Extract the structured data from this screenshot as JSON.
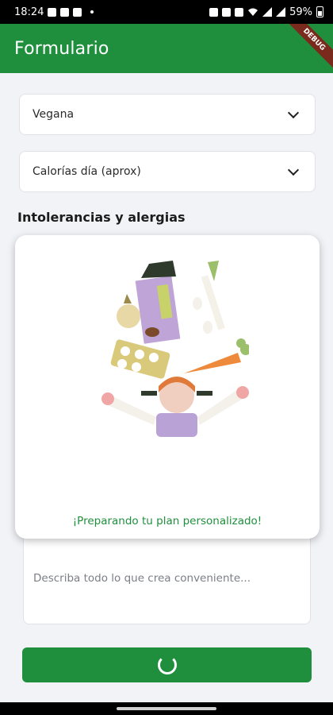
{
  "status_bar": {
    "time": "18:24",
    "battery": "59%"
  },
  "app_bar": {
    "title": "Formulario",
    "debug_label": "DEBUG"
  },
  "form": {
    "diet_select": {
      "value": "Vegana"
    },
    "calories_select": {
      "placeholder": "Calorías día (aprox)"
    },
    "allergies_title": "Intolerancias y alergias",
    "details_field": {
      "placeholder": "Describa todo lo que crea conveniente..."
    }
  },
  "loading_card": {
    "message": "¡Preparando tu plan personalizado!"
  },
  "colors": {
    "primary": "#1f8f3d",
    "background": "#f1f3f7",
    "card": "#ffffff"
  },
  "icons": [
    "picture-icon",
    "youtube-icon",
    "twitch-icon",
    "lock-icon",
    "wifi-icon",
    "signal-icon",
    "battery-icon",
    "chevron-down-icon",
    "spinner-icon"
  ]
}
